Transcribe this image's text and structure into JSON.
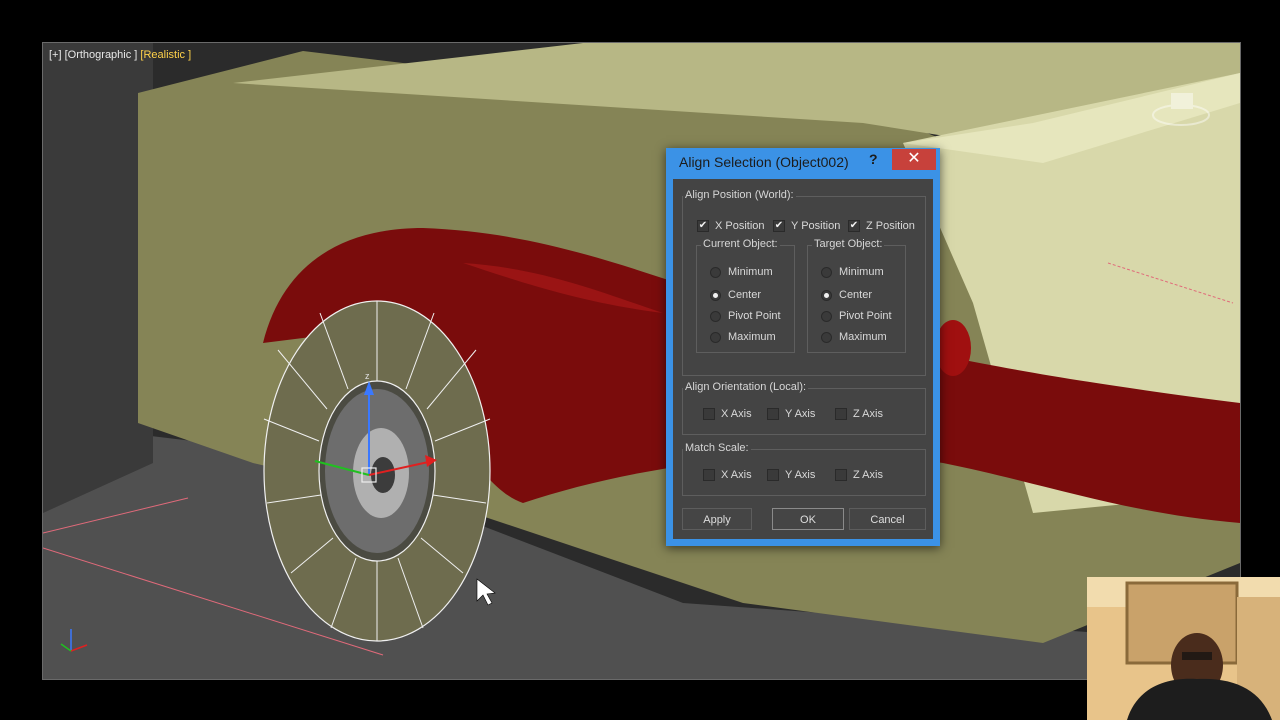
{
  "viewport": {
    "label": "[+] [Orthographic ] ",
    "shading": "[Realistic ]"
  },
  "dialog": {
    "title": "Align Selection (Object002)",
    "help": "?",
    "close": "✕",
    "align_position": {
      "label": "Align Position (World):",
      "x": {
        "label": "X Position",
        "checked": true
      },
      "y": {
        "label": "Y Position",
        "checked": true
      },
      "z": {
        "label": "Z Position",
        "checked": true
      },
      "current_object": {
        "label": "Current Object:",
        "options": [
          "Minimum",
          "Center",
          "Pivot Point",
          "Maximum"
        ],
        "selected": "Center"
      },
      "target_object": {
        "label": "Target Object:",
        "options": [
          "Minimum",
          "Center",
          "Pivot Point",
          "Maximum"
        ],
        "selected": "Center"
      }
    },
    "align_orientation": {
      "label": "Align Orientation (Local):",
      "x": {
        "label": "X Axis",
        "checked": false
      },
      "y": {
        "label": "Y Axis",
        "checked": false
      },
      "z": {
        "label": "Z Axis",
        "checked": false
      }
    },
    "match_scale": {
      "label": "Match Scale:",
      "x": {
        "label": "X Axis",
        "checked": false
      },
      "y": {
        "label": "Y Axis",
        "checked": false
      },
      "z": {
        "label": "Z Axis",
        "checked": false
      }
    },
    "buttons": {
      "apply": "Apply",
      "ok": "OK",
      "cancel": "Cancel"
    }
  },
  "gizmo": {
    "z_label": "z"
  },
  "colors": {
    "dialog_frame": "#3b92e6",
    "close_button": "#c7413b",
    "car_body": "#7a0c0c",
    "wall": "#c9c99a",
    "ground": "#4f4f4f"
  }
}
